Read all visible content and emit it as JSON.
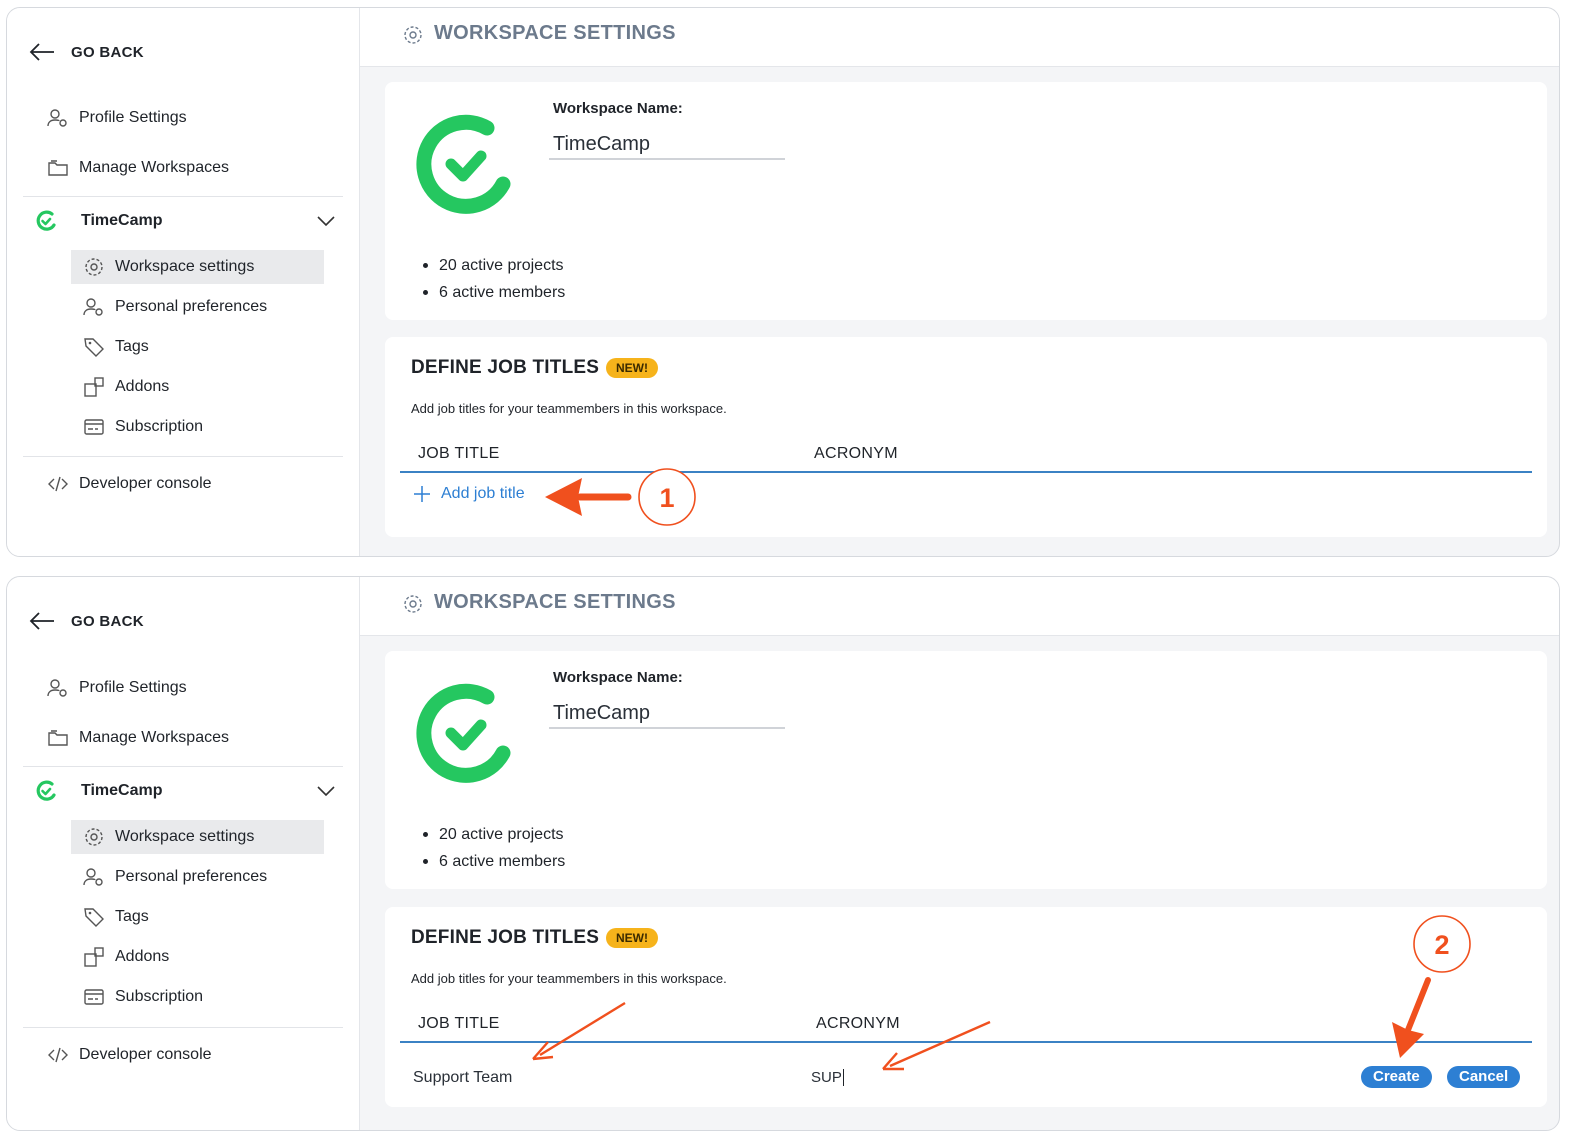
{
  "sidebar": {
    "go_back": "GO BACK",
    "profile_settings": "Profile Settings",
    "manage_workspaces": "Manage Workspaces",
    "workspace_name": "TimeCamp",
    "sub_items": [
      "Workspace settings",
      "Personal preferences",
      "Tags",
      "Addons",
      "Subscription"
    ],
    "developer_console": "Developer console"
  },
  "header": {
    "title": "WORKSPACE SETTINGS"
  },
  "workspace": {
    "name_label": "Workspace Name:",
    "name_value": "TimeCamp",
    "active_projects": "20 active projects",
    "active_members": "6 active members"
  },
  "job_titles": {
    "title": "DEFINE JOB TITLES",
    "badge": "NEW!",
    "description": "Add job titles for your teammembers in this workspace.",
    "col_job_title": "JOB TITLE",
    "col_acronym": "ACRONYM",
    "add_label": "Add job title",
    "new_job_title": "Support Team",
    "new_acronym": "SUP",
    "create_label": "Create",
    "cancel_label": "Cancel"
  },
  "annotations": {
    "step1": "1",
    "step2": "2"
  },
  "colors": {
    "brand_green": "#25c760",
    "accent_blue": "#2d7fd3",
    "badge_yellow": "#f6b31b",
    "annotation_orange": "#f0501e"
  }
}
